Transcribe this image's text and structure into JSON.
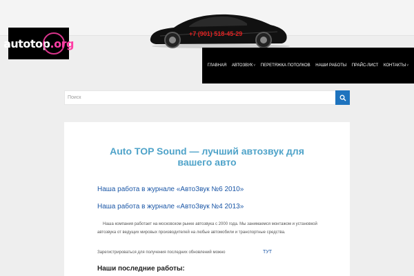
{
  "logo": {
    "part1": "autotop",
    "part2": ".org"
  },
  "header": {
    "phone": "+7 (901) 518-45-29"
  },
  "nav": {
    "items": [
      {
        "label": "ГЛАВНАЯ",
        "dropdown": false
      },
      {
        "label": "АВТОЗВУК",
        "dropdown": true
      },
      {
        "label": "ПЕРЕТЯЖКА ПОТОЛКОВ",
        "dropdown": false
      },
      {
        "label": "НАШИ РАБОТЫ",
        "dropdown": false
      },
      {
        "label": "ПРАЙС-ЛИСТ",
        "dropdown": false
      },
      {
        "label": "КОНТАКТЫ",
        "dropdown": true
      }
    ],
    "chevron": "˅"
  },
  "search": {
    "placeholder": "Поиск",
    "button_icon": "search-icon"
  },
  "main": {
    "title": "Auto TOP Sound — лучший автозвук для вашего авто",
    "links": [
      "Наша работа в журнале «АвтоЗвук №6 2010»",
      "Наша работа в журнале «АвтоЗвук №4 2013»"
    ],
    "paragraph": "Наша компания работает на московском рынке автозвука с 2000 года. Мы занимаемся монтажом и установкой автозвука от ведущих мировых производителей на любые автомобили и транспортные средства.",
    "register_text": "Зарегистрироваться для получения последних обновлений можно",
    "register_link": "ТУТ",
    "recent_heading": "Наши последние работы:"
  },
  "colors": {
    "accent": "#1e73be",
    "title": "#4fa3c9",
    "link": "#1a56a6",
    "logo_pink": "#ff3ea5"
  }
}
